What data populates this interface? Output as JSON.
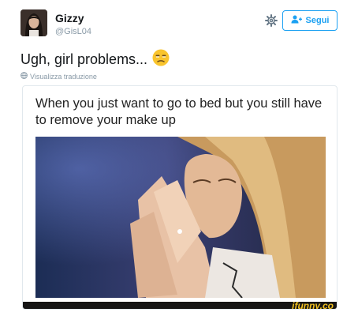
{
  "user": {
    "display_name": "Gizzy",
    "handle": "@GisL04"
  },
  "actions": {
    "settings_icon": "gear-icon",
    "follow_icon": "add-user-icon",
    "follow_label": "Segui"
  },
  "tweet": {
    "text": "Ugh, girl problems...",
    "emoji_icon": "unamused-face-emoji",
    "translate_label": "Visualizza traduzione",
    "translate_icon": "globe-icon"
  },
  "media": {
    "caption": "When you just want to go to bed but you still have to remove your make up",
    "watermark": "ifunny.co"
  },
  "colors": {
    "accent": "#1da1f2",
    "muted": "#8899a6",
    "watermark": "#f0c020"
  }
}
